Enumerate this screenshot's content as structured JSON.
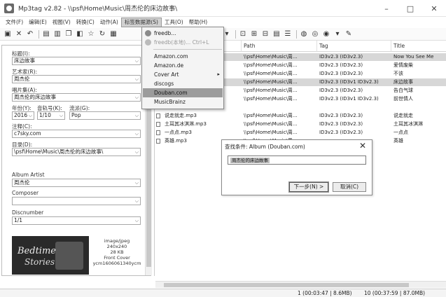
{
  "window": {
    "title": "Mp3tag v2.82  -  \\\\psf\\Home\\Music\\周杰伦的床边故事\\",
    "minimize": "–",
    "maximize": "□",
    "close": "✕"
  },
  "menu": [
    "文件(F)",
    "编辑(E)",
    "视图(V)",
    "转换(C)",
    "动作(A)",
    "标签数据源(S)",
    "工具(O)",
    "帮助(H)"
  ],
  "tag_panel": {
    "title_label": "标题(I):",
    "title_value": "床边故事",
    "artist_label": "艺术家(R):",
    "artist_value": "周杰伦",
    "album_label": "唱片集(A):",
    "album_value": "周杰伦的床边故事",
    "year_label": "年份(Y):",
    "year_value": "2016",
    "track_label": "音轨号(K):",
    "track_value": "1/10",
    "genre_label": "流派(G):",
    "genre_value": "Pop",
    "comment_label": "注释(C):",
    "comment_value": "c7sky.com",
    "directory_label": "目录(D):",
    "directory_value": "\\psf\\Home\\Music\\周杰伦的床边故事\\",
    "album_artist_label": "Album Artist",
    "album_artist_value": "周杰伦",
    "composer_label": "Composer",
    "composer_value": "",
    "discnumber_label": "Discnumber",
    "discnumber_value": "1/1",
    "cover": {
      "art_line1": "Bedtime",
      "art_line2": "Stories",
      "mime": "image/jpeg",
      "dimensions": "240x240",
      "size": "28 KB",
      "type": "Front Cover",
      "desc": "ycm1606061340ycm"
    }
  },
  "file_list": {
    "columns": {
      "path": "Path",
      "tag": "Tag",
      "title": "Title"
    },
    "rows": [
      {
        "file": "",
        "path": "\\\\psf\\Home\\Music\\周...",
        "tag": "ID3v2.3 (ID3v2.3)",
        "title": "Now You See Me",
        "selected": true
      },
      {
        "file": "",
        "path": "\\\\psf\\Home\\Music\\周...",
        "tag": "ID3v2.3 (ID3v2.3)",
        "title": "爱情废柴",
        "selected": false
      },
      {
        "file": "",
        "path": "\\\\psf\\Home\\Music\\周...",
        "tag": "ID3v2.3 (ID3v2.3)",
        "title": "不该",
        "selected": false
      },
      {
        "file": "",
        "path": "\\\\psf\\Home\\Music\\周...",
        "tag": "ID3v2.3 (ID3v1 ID3v2.3)",
        "title": "床边故事",
        "selected": true
      },
      {
        "file": "",
        "path": "\\\\psf\\Home\\Music\\周...",
        "tag": "ID3v2.3 (ID3v2.3)",
        "title": "告白气球",
        "selected": false
      },
      {
        "file": "",
        "path": "\\\\psf\\Home\\Music\\周...",
        "tag": "ID3v2.3 (ID3v1 ID3v2.3)",
        "title": "前世情人",
        "selected": false
      },
      {
        "file": "说走就走.mp3",
        "path": "\\\\psf\\Home\\Music\\周...",
        "tag": "ID3v2.3 (ID3v2.3)",
        "title": "说走就走",
        "selected": false
      },
      {
        "file": "土耳其冰淇淋.mp3",
        "path": "\\\\psf\\Home\\Music\\周...",
        "tag": "ID3v2.3 (ID3v2.3)",
        "title": "土耳其冰淇淋",
        "selected": false
      },
      {
        "file": "一点点.mp3",
        "path": "\\\\psf\\Home\\Music\\周...",
        "tag": "ID3v2.3 (ID3v2.3)",
        "title": "一点点",
        "selected": false
      },
      {
        "file": "英雄.mp3",
        "path": "\\\\psf\\Home\\Music\\周...",
        "tag": "",
        "title": "英雄",
        "selected": false
      }
    ]
  },
  "dropdown": {
    "items": [
      {
        "label": "freedb...",
        "disabled": false,
        "icon": "globe-icon",
        "submenu": false
      },
      {
        "label": "freedb(本地)...  Ctrl+L",
        "disabled": true,
        "icon": "database-icon",
        "submenu": false
      },
      {
        "label": "Amazon.com",
        "disabled": false,
        "icon": "",
        "submenu": false
      },
      {
        "label": "Amazon.de",
        "disabled": false,
        "icon": "",
        "submenu": false
      },
      {
        "label": "Cover Art",
        "disabled": false,
        "icon": "",
        "submenu": true
      },
      {
        "label": "discogs",
        "disabled": false,
        "icon": "",
        "submenu": false
      },
      {
        "label": "Douban.com",
        "disabled": false,
        "icon": "",
        "submenu": false,
        "hover": true
      },
      {
        "label": "MusicBrainz",
        "disabled": false,
        "icon": "",
        "submenu": false
      }
    ]
  },
  "dialog": {
    "title": "查找条件: Album (Douban.com)",
    "close": "✕",
    "query": "周杰伦的床边故事",
    "next_button": "下一步(N) >",
    "cancel_button": "取消(C)"
  },
  "status": {
    "selection": "1 (00:03:47 | 8.6MB)",
    "total": "10 (00:37:59 | 87.0MB)"
  }
}
